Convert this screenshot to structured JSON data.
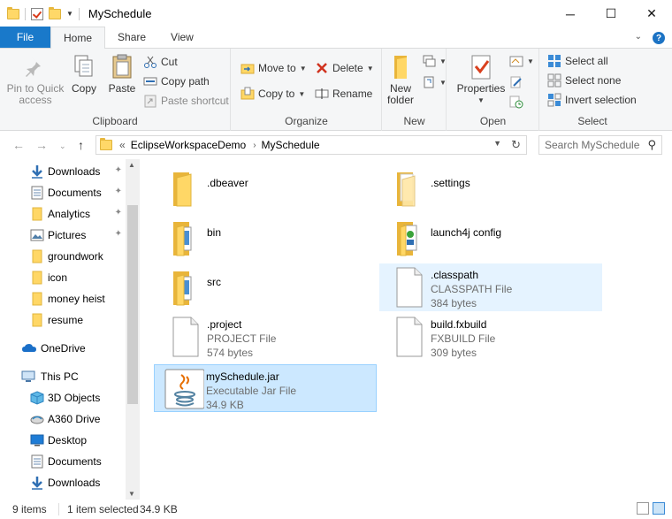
{
  "window": {
    "title": "MySchedule",
    "minimize_glyph": "─",
    "maximize_glyph": "☐",
    "close_glyph": "✕"
  },
  "tabs": [
    {
      "label": "File"
    },
    {
      "label": "Home"
    },
    {
      "label": "Share"
    },
    {
      "label": "View"
    }
  ],
  "ribbon": {
    "clipboard": {
      "label": "Clipboard",
      "pin_to_quick_access": "Pin to Quick access",
      "copy": "Copy",
      "paste": "Paste",
      "cut": "Cut",
      "copy_path": "Copy path",
      "paste_shortcut": "Paste shortcut"
    },
    "organize": {
      "label": "Organize",
      "move_to": "Move to",
      "copy_to": "Copy to",
      "delete": "Delete",
      "rename": "Rename"
    },
    "new": {
      "label": "New",
      "new_folder": "New folder"
    },
    "open": {
      "label": "Open",
      "properties": "Properties"
    },
    "select": {
      "label": "Select",
      "select_all": "Select all",
      "select_none": "Select none",
      "invert_selection": "Invert selection"
    }
  },
  "address": {
    "prefix": "«",
    "crumbs": [
      "EclipseWorkspaceDemo",
      "MySchedule"
    ],
    "search_placeholder": "Search MySchedule"
  },
  "nav": [
    {
      "label": "Downloads",
      "icon": "download-arrow-icon",
      "pinned": true
    },
    {
      "label": "Documents",
      "icon": "documents-icon",
      "pinned": true
    },
    {
      "label": "Analytics",
      "icon": "folder-icon",
      "pinned": true
    },
    {
      "label": "Pictures",
      "icon": "pictures-icon",
      "pinned": true
    },
    {
      "label": "groundwork",
      "icon": "folder-icon",
      "pinned": false
    },
    {
      "label": "icon",
      "icon": "folder-icon",
      "pinned": false
    },
    {
      "label": "money heist",
      "icon": "folder-icon",
      "pinned": false
    },
    {
      "label": "resume",
      "icon": "folder-icon",
      "pinned": false
    },
    {
      "label": "OneDrive",
      "icon": "cloud-icon",
      "pinned": false
    },
    {
      "label": "This PC",
      "icon": "computer-icon",
      "pinned": false
    },
    {
      "label": "3D Objects",
      "icon": "cube-icon",
      "pinned": false
    },
    {
      "label": "A360 Drive",
      "icon": "drive-icon",
      "pinned": false
    },
    {
      "label": "Desktop",
      "icon": "desktop-icon",
      "pinned": false
    },
    {
      "label": "Documents",
      "icon": "documents-icon",
      "pinned": false
    },
    {
      "label": "Downloads",
      "icon": "download-arrow-icon",
      "pinned": false
    }
  ],
  "files": [
    {
      "name": ".dbeaver",
      "kind": "folder"
    },
    {
      "name": ".settings",
      "kind": "folder-doc"
    },
    {
      "name": "bin",
      "kind": "folder-doc"
    },
    {
      "name": "launch4j config",
      "kind": "folder-doc"
    },
    {
      "name": "src",
      "kind": "folder-doc"
    },
    {
      "name": ".classpath",
      "type": "CLASSPATH File",
      "size": "384 bytes",
      "kind": "file"
    },
    {
      "name": ".project",
      "type": "PROJECT File",
      "size": "574 bytes",
      "kind": "file"
    },
    {
      "name": "build.fxbuild",
      "type": "FXBUILD File",
      "size": "309 bytes",
      "kind": "file"
    },
    {
      "name": "mySchedule.jar",
      "type": "Executable Jar File",
      "size": "34.9 KB",
      "kind": "jar"
    }
  ],
  "status": {
    "item_count": "9 items",
    "selection": "1 item selected",
    "selection_size": "34.9 KB"
  },
  "colors": {
    "accent": "#1979ca",
    "selection_bg": "#cce8ff",
    "hover_bg": "#e5f3ff",
    "folder_yellow": "#ffd766"
  }
}
